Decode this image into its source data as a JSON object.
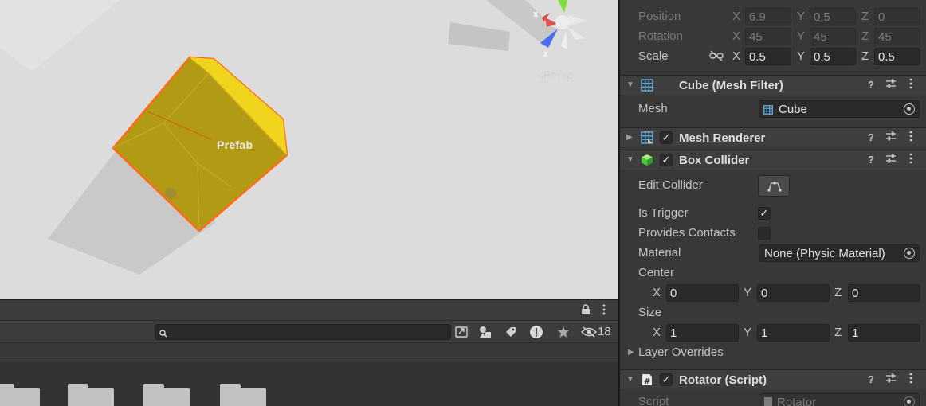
{
  "scene": {
    "prefab_label": "Prefab",
    "persp_label": "<Persp",
    "gizmo": {
      "x_label": "x",
      "z_label": "z"
    },
    "colors": {
      "cube_fill": "#b39a14",
      "cube_top": "#f0d41e",
      "outline": "#ff6a1a",
      "background": "#dcdcdc"
    }
  },
  "project": {
    "search": {
      "value": "",
      "placeholder": ""
    },
    "hidden_count": "18",
    "icons": [
      "lock-icon",
      "kebab-menu-icon",
      "search-icon",
      "open-window-icon",
      "filter-type-icon",
      "label-tag-icon",
      "error-icon",
      "star-icon",
      "visibility-hidden-icon"
    ]
  },
  "inspector": {
    "transform": {
      "position": {
        "label": "Position",
        "x": "6.9",
        "y": "0.5",
        "z": "0"
      },
      "rotation": {
        "label": "Rotation",
        "x": "45",
        "y": "45",
        "z": "45"
      },
      "scale": {
        "label": "Scale",
        "x": "0.5",
        "y": "0.5",
        "z": "0.5"
      },
      "axis": {
        "x": "X",
        "y": "Y",
        "z": "Z"
      }
    },
    "mesh_filter": {
      "title": "Cube (Mesh Filter)",
      "mesh_label": "Mesh",
      "mesh_value": "Cube"
    },
    "mesh_renderer": {
      "title": "Mesh Renderer",
      "enabled": true
    },
    "box_collider": {
      "title": "Box Collider",
      "enabled": true,
      "edit_collider_label": "Edit Collider",
      "is_trigger_label": "Is Trigger",
      "is_trigger": true,
      "provides_contacts_label": "Provides Contacts",
      "provides_contacts": false,
      "material_label": "Material",
      "material_value": "None (Physic Material)",
      "center_label": "Center",
      "center": {
        "x": "0",
        "y": "0",
        "z": "0"
      },
      "size_label": "Size",
      "size": {
        "x": "1",
        "y": "1",
        "z": "1"
      },
      "layer_overrides_label": "Layer Overrides"
    },
    "rotator": {
      "title": "Rotator (Script)",
      "enabled": true,
      "script_label": "Script",
      "script_value": "Rotator"
    },
    "header_icons": [
      "help-icon",
      "presets-icon",
      "kebab-menu-icon"
    ],
    "check_mark": "✓",
    "colors": {
      "bg": "#383838",
      "field": "#2a2a2a",
      "header": "#3e3e3e"
    }
  }
}
